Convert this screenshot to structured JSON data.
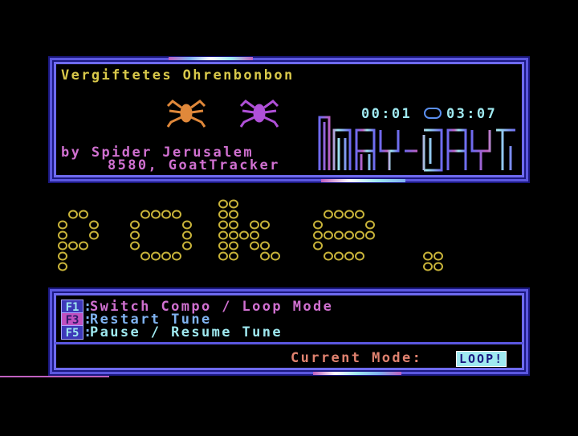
{
  "header": {
    "title": "Vergiftetes Ohrenbonbon",
    "credit": "by Spider Jerusalem",
    "info": "8580, GoatTracker",
    "time_elapsed": "00:01",
    "time_total": "03:07",
    "logo_text": "MAY-DAY",
    "title_color": "#d8c84a",
    "credit_color": "#d070d0",
    "info_color": "#d070d0",
    "timer_color": "#9fe9f0"
  },
  "banner": {
    "text": "poke."
  },
  "menu": {
    "items": [
      {
        "key": "F1",
        "label": "Switch Compo / Loop Mode",
        "color": "#d070d0"
      },
      {
        "key": "F3",
        "label": "Restart Tune",
        "color": "#7fb2f0"
      },
      {
        "key": "F5",
        "label": "Pause / Resume Tune",
        "color": "#9fe9f0"
      }
    ],
    "mode_label": "Current Mode:",
    "mode_value": "LOOP!",
    "mode_label_color": "#e0826f"
  },
  "icons": [
    "spider-icon",
    "spider-icon",
    "timer-separator-icon"
  ]
}
